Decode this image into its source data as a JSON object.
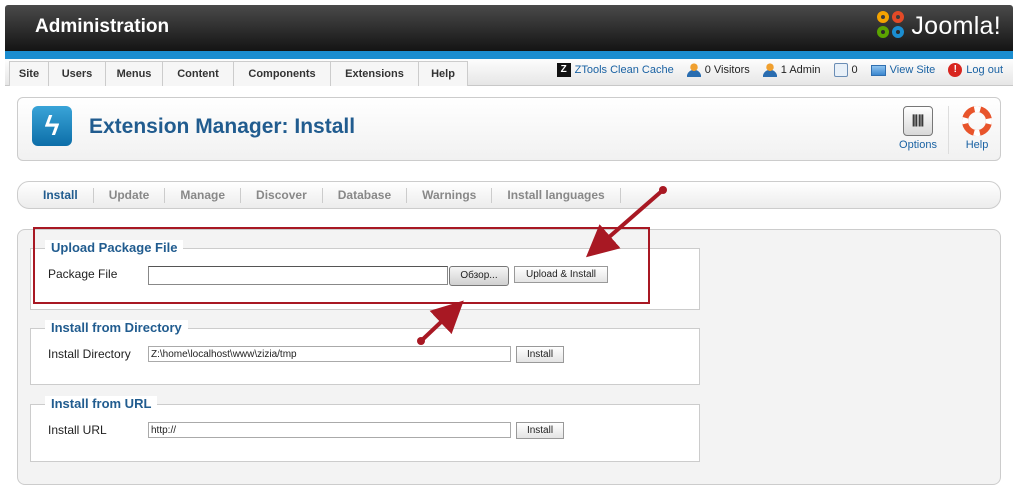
{
  "header": {
    "title": "Administration",
    "logo_text": "Joomla!"
  },
  "menu": {
    "items": [
      {
        "label": "Site"
      },
      {
        "label": "Users"
      },
      {
        "label": "Menus"
      },
      {
        "label": "Content"
      },
      {
        "label": "Components"
      },
      {
        "label": "Extensions"
      },
      {
        "label": "Help"
      }
    ]
  },
  "status": {
    "ztools_label": "ZTools Clean Cache",
    "visitors": "0 Visitors",
    "admins": "1 Admin",
    "messages": "0",
    "view_site": "View Site",
    "logout": "Log out"
  },
  "toolbar": {
    "title": "Extension Manager: Install",
    "options_label": "Options",
    "help_label": "Help"
  },
  "submenu": {
    "items": [
      {
        "label": "Install",
        "active": true
      },
      {
        "label": "Update"
      },
      {
        "label": "Manage"
      },
      {
        "label": "Discover"
      },
      {
        "label": "Database"
      },
      {
        "label": "Warnings"
      },
      {
        "label": "Install languages"
      }
    ]
  },
  "upload": {
    "legend": "Upload Package File",
    "label": "Package File",
    "value": "",
    "browse_label": "Обзор...",
    "button_label": "Upload & Install"
  },
  "directory": {
    "legend": "Install from Directory",
    "label": "Install Directory",
    "value": "Z:\\home\\localhost\\www\\zizia/tmp",
    "button_label": "Install"
  },
  "url": {
    "legend": "Install from URL",
    "label": "Install URL",
    "value": "http://",
    "button_label": "Install"
  },
  "colors": {
    "header_dark": "#141414",
    "accent_blue": "#1b8dd0",
    "title_blue": "#215c8f",
    "annotation_red": "#a81823"
  },
  "icons": [
    "joomla-logo-icon",
    "ztools-icon",
    "visitors-icon",
    "admin-icon",
    "messages-icon",
    "view-site-icon",
    "logout-icon",
    "extension-icon",
    "options-icon",
    "help-lifebuoy-icon"
  ]
}
